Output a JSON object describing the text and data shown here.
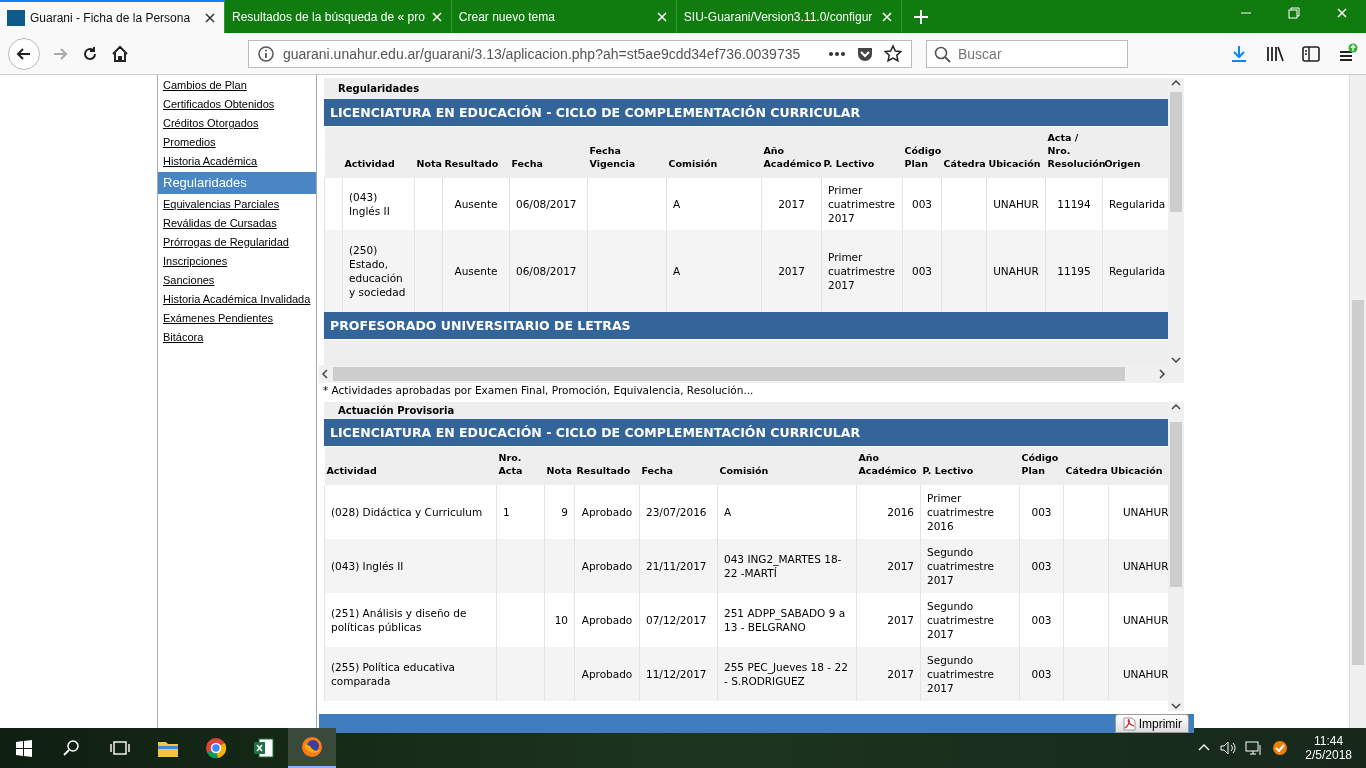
{
  "browser": {
    "tabs": [
      {
        "title": "Guarani - Ficha de la Persona",
        "selected": true,
        "kind": "siu"
      },
      {
        "title": "Resultados de la búsqueda de « pro",
        "selected": false
      },
      {
        "title": "Crear nuevo tema",
        "selected": false
      },
      {
        "title": "SIU-Guarani/Version3.11.0/configur",
        "selected": false
      }
    ],
    "url": "guarani.unahur.edu.ar/guarani/3.13/aplicacion.php?ah=st5ae9cdd34ef736.0039735",
    "search": {
      "placeholder": "Buscar"
    }
  },
  "sidebar": {
    "items": [
      {
        "label": "Cambios de Plan",
        "selected": false
      },
      {
        "label": "Certificados Obtenidos",
        "selected": false
      },
      {
        "label": "Créditos Otorgados",
        "selected": false
      },
      {
        "label": "Promedios",
        "selected": false
      },
      {
        "label": "Historia Académica",
        "selected": false
      },
      {
        "label": "Regularidades",
        "selected": true
      },
      {
        "label": "Equivalencias Parciales",
        "selected": false
      },
      {
        "label": "Reválidas de Cursadas",
        "selected": false
      },
      {
        "label": "Prórrogas de Regularidad",
        "selected": false
      },
      {
        "label": "Inscripciones",
        "selected": false
      },
      {
        "label": "Sanciones",
        "selected": false
      },
      {
        "label": "Historia Académica Invalidada",
        "selected": false
      },
      {
        "label": "Exámenes Pendientes",
        "selected": false
      },
      {
        "label": "Bitácora",
        "selected": false
      }
    ]
  },
  "regularidades": {
    "title": "Regularidades",
    "sections": [
      {
        "title": "LICENCIATURA EN EDUCACIÓN - CICLO DE COMPLEMENTACIÓN CURRICULAR",
        "columns": [
          "Actividad",
          "Nota",
          "Resultado",
          "Fecha",
          "Fecha Vigencia",
          "Comisión",
          "Año Académico",
          "P. Lectivo",
          "Código Plan",
          "Cátedra",
          "Ubicación",
          "Acta / Nro. Resolución",
          "Origen"
        ],
        "rows": [
          [
            "(043) Inglés II",
            null,
            "Ausente",
            "06/08/2017",
            null,
            "A",
            "2017",
            "Primer cuatrimestre 2017",
            "003",
            null,
            "UNAHUR",
            "11194",
            "Regularida"
          ],
          [
            "(250) Estado, educación y sociedad",
            null,
            "Ausente",
            "06/08/2017",
            null,
            "A",
            "2017",
            "Primer cuatrimestre 2017",
            "003",
            null,
            "UNAHUR",
            "11195",
            "Regularida"
          ]
        ]
      },
      {
        "title": "PROFESORADO UNIVERSITARIO DE LETRAS"
      }
    ],
    "footnote": "* Actividades aprobadas por Examen Final, Promoción, Equivalencia, Resolución..."
  },
  "actuacion": {
    "title": "Actuación Provisoria",
    "sections": [
      {
        "title": "LICENCIATURA EN EDUCACIÓN - CICLO DE COMPLEMENTACIÓN CURRICULAR",
        "columns": [
          "Actividad",
          "Nro. Acta",
          "Nota",
          "Resultado",
          "Fecha",
          "Comisión",
          "Año Académico",
          "P. Lectivo",
          "Código Plan",
          "Cátedra",
          "Ubicación"
        ],
        "rows": [
          [
            "(028) Didáctica y Curriculum",
            "1",
            "9",
            "Aprobado",
            "23/07/2016",
            "A",
            "2016",
            "Primer cuatrimestre 2016",
            "003",
            null,
            "UNAHUR"
          ],
          [
            "(043) Inglés II",
            null,
            null,
            "Aprobado",
            "21/11/2017",
            "043 ING2_MARTES 18-22 -MARTÍ",
            "2017",
            "Segundo cuatrimestre 2017",
            "003",
            null,
            "UNAHUR"
          ],
          [
            "(251) Análisis y diseño de políticas públicas",
            null,
            "10",
            "Aprobado",
            "07/12/2017",
            "251 ADPP_SABADO 9 a 13 - BELGRANO",
            "2017",
            "Segundo cuatrimestre 2017",
            "003",
            null,
            "UNAHUR"
          ],
          [
            "(255) Política educativa comparada",
            null,
            null,
            "Aprobado",
            "11/12/2017",
            "255 PEC_Jueves 18 - 22 - S.RODRIGUEZ",
            "2017",
            "Segundo cuatrimestre 2017",
            "003",
            null,
            "UNAHUR"
          ]
        ]
      }
    ]
  },
  "print_button": "Imprimir",
  "taskbar": {
    "time": "11:44",
    "date": "2/5/2018"
  }
}
